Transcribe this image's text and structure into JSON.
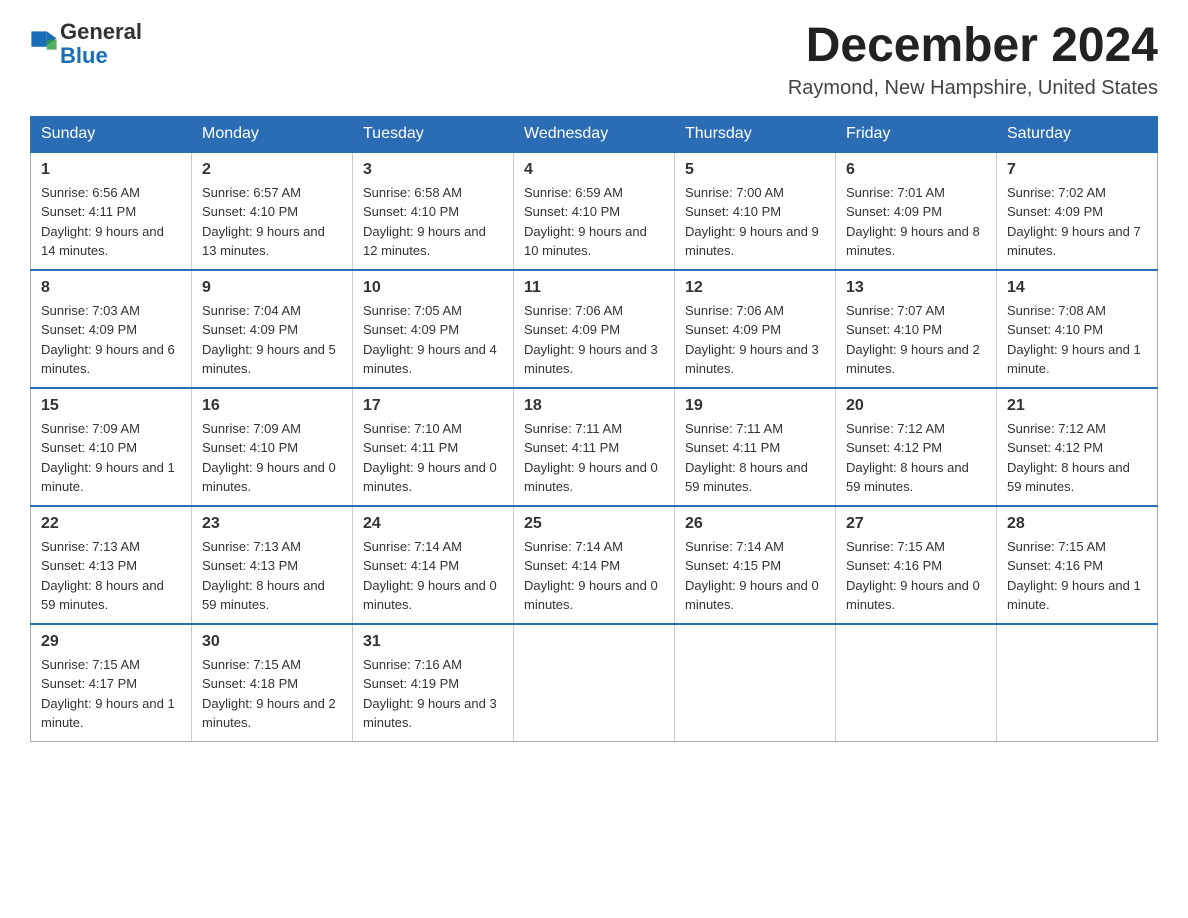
{
  "header": {
    "logo_text_general": "General",
    "logo_text_blue": "Blue",
    "month_title": "December 2024",
    "location": "Raymond, New Hampshire, United States"
  },
  "weekdays": [
    "Sunday",
    "Monday",
    "Tuesday",
    "Wednesday",
    "Thursday",
    "Friday",
    "Saturday"
  ],
  "weeks": [
    [
      {
        "day": "1",
        "sunrise": "6:56 AM",
        "sunset": "4:11 PM",
        "daylight": "9 hours and 14 minutes."
      },
      {
        "day": "2",
        "sunrise": "6:57 AM",
        "sunset": "4:10 PM",
        "daylight": "9 hours and 13 minutes."
      },
      {
        "day": "3",
        "sunrise": "6:58 AM",
        "sunset": "4:10 PM",
        "daylight": "9 hours and 12 minutes."
      },
      {
        "day": "4",
        "sunrise": "6:59 AM",
        "sunset": "4:10 PM",
        "daylight": "9 hours and 10 minutes."
      },
      {
        "day": "5",
        "sunrise": "7:00 AM",
        "sunset": "4:10 PM",
        "daylight": "9 hours and 9 minutes."
      },
      {
        "day": "6",
        "sunrise": "7:01 AM",
        "sunset": "4:09 PM",
        "daylight": "9 hours and 8 minutes."
      },
      {
        "day": "7",
        "sunrise": "7:02 AM",
        "sunset": "4:09 PM",
        "daylight": "9 hours and 7 minutes."
      }
    ],
    [
      {
        "day": "8",
        "sunrise": "7:03 AM",
        "sunset": "4:09 PM",
        "daylight": "9 hours and 6 minutes."
      },
      {
        "day": "9",
        "sunrise": "7:04 AM",
        "sunset": "4:09 PM",
        "daylight": "9 hours and 5 minutes."
      },
      {
        "day": "10",
        "sunrise": "7:05 AM",
        "sunset": "4:09 PM",
        "daylight": "9 hours and 4 minutes."
      },
      {
        "day": "11",
        "sunrise": "7:06 AM",
        "sunset": "4:09 PM",
        "daylight": "9 hours and 3 minutes."
      },
      {
        "day": "12",
        "sunrise": "7:06 AM",
        "sunset": "4:09 PM",
        "daylight": "9 hours and 3 minutes."
      },
      {
        "day": "13",
        "sunrise": "7:07 AM",
        "sunset": "4:10 PM",
        "daylight": "9 hours and 2 minutes."
      },
      {
        "day": "14",
        "sunrise": "7:08 AM",
        "sunset": "4:10 PM",
        "daylight": "9 hours and 1 minute."
      }
    ],
    [
      {
        "day": "15",
        "sunrise": "7:09 AM",
        "sunset": "4:10 PM",
        "daylight": "9 hours and 1 minute."
      },
      {
        "day": "16",
        "sunrise": "7:09 AM",
        "sunset": "4:10 PM",
        "daylight": "9 hours and 0 minutes."
      },
      {
        "day": "17",
        "sunrise": "7:10 AM",
        "sunset": "4:11 PM",
        "daylight": "9 hours and 0 minutes."
      },
      {
        "day": "18",
        "sunrise": "7:11 AM",
        "sunset": "4:11 PM",
        "daylight": "9 hours and 0 minutes."
      },
      {
        "day": "19",
        "sunrise": "7:11 AM",
        "sunset": "4:11 PM",
        "daylight": "8 hours and 59 minutes."
      },
      {
        "day": "20",
        "sunrise": "7:12 AM",
        "sunset": "4:12 PM",
        "daylight": "8 hours and 59 minutes."
      },
      {
        "day": "21",
        "sunrise": "7:12 AM",
        "sunset": "4:12 PM",
        "daylight": "8 hours and 59 minutes."
      }
    ],
    [
      {
        "day": "22",
        "sunrise": "7:13 AM",
        "sunset": "4:13 PM",
        "daylight": "8 hours and 59 minutes."
      },
      {
        "day": "23",
        "sunrise": "7:13 AM",
        "sunset": "4:13 PM",
        "daylight": "8 hours and 59 minutes."
      },
      {
        "day": "24",
        "sunrise": "7:14 AM",
        "sunset": "4:14 PM",
        "daylight": "9 hours and 0 minutes."
      },
      {
        "day": "25",
        "sunrise": "7:14 AM",
        "sunset": "4:14 PM",
        "daylight": "9 hours and 0 minutes."
      },
      {
        "day": "26",
        "sunrise": "7:14 AM",
        "sunset": "4:15 PM",
        "daylight": "9 hours and 0 minutes."
      },
      {
        "day": "27",
        "sunrise": "7:15 AM",
        "sunset": "4:16 PM",
        "daylight": "9 hours and 0 minutes."
      },
      {
        "day": "28",
        "sunrise": "7:15 AM",
        "sunset": "4:16 PM",
        "daylight": "9 hours and 1 minute."
      }
    ],
    [
      {
        "day": "29",
        "sunrise": "7:15 AM",
        "sunset": "4:17 PM",
        "daylight": "9 hours and 1 minute."
      },
      {
        "day": "30",
        "sunrise": "7:15 AM",
        "sunset": "4:18 PM",
        "daylight": "9 hours and 2 minutes."
      },
      {
        "day": "31",
        "sunrise": "7:16 AM",
        "sunset": "4:19 PM",
        "daylight": "9 hours and 3 minutes."
      },
      null,
      null,
      null,
      null
    ]
  ]
}
